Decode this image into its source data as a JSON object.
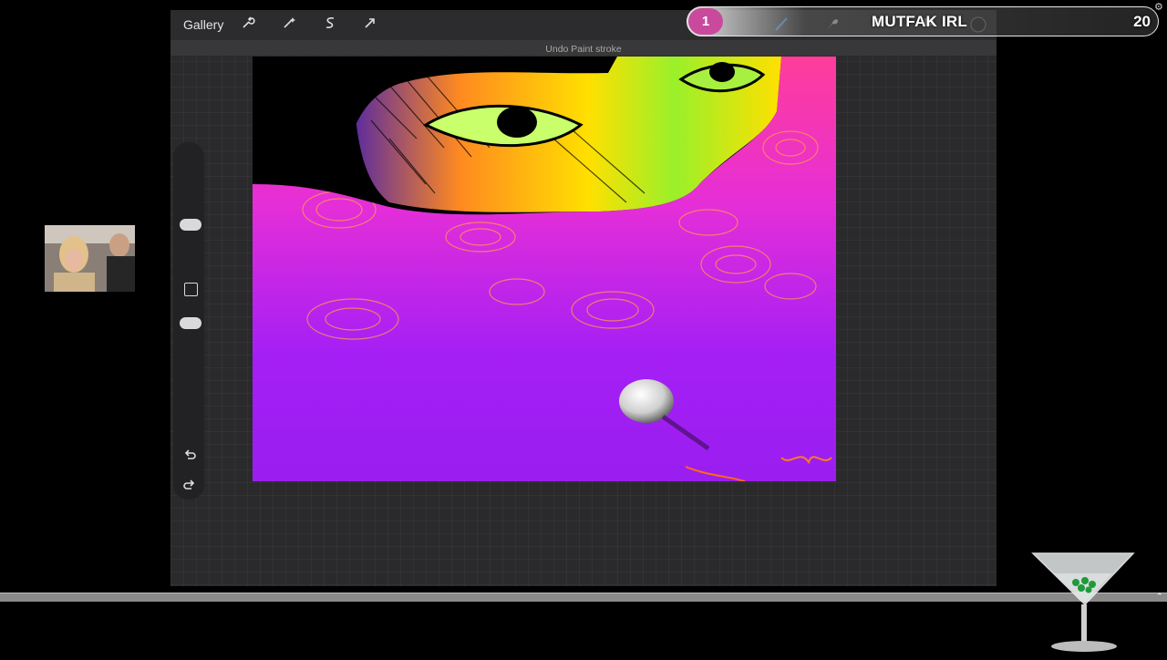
{
  "app": {
    "gallery_label": "Gallery",
    "status_text": "Undo Paint stroke",
    "tools_left": [
      "wrench-icon",
      "magic-wand-icon",
      "selection-s-icon",
      "transform-arrow-icon"
    ],
    "tools_right": [
      "brush-icon",
      "smudge-icon",
      "eraser-icon",
      "layers-icon",
      "color-swatch-icon"
    ]
  },
  "sidebar": {
    "buttons": [
      "brush-size-slider",
      "modify-button",
      "opacity-slider",
      "undo-icon",
      "redo-icon"
    ]
  },
  "overlay": {
    "badge_number": "1",
    "channel_name": "MUTFAK IRL",
    "count": "20"
  },
  "colors": {
    "app_bg": "#2a2a2c",
    "toolbar_bg": "#2c2c2e",
    "badge": "#c94a9c",
    "canvas_magenta": "#9b1ff2",
    "canvas_pink": "#ff3d9a"
  }
}
